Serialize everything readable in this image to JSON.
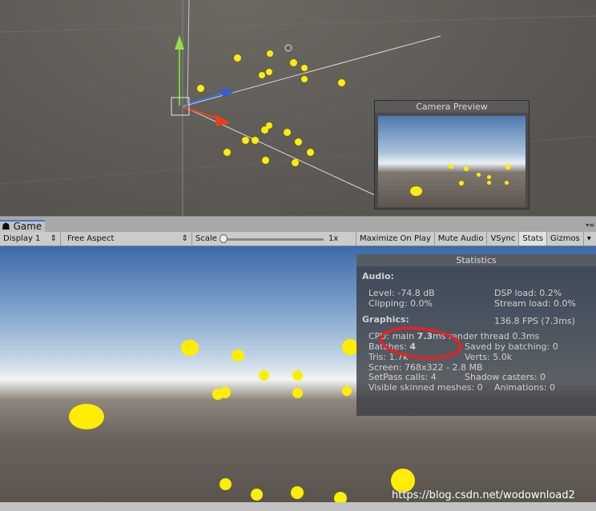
{
  "preview": {
    "title": "Camera Preview"
  },
  "tab": {
    "label": "Game"
  },
  "toolbar": {
    "display": "Display 1",
    "aspect": "Free Aspect",
    "scale_label": "Scale",
    "scale_value": "1x",
    "maximize": "Maximize On Play",
    "mute": "Mute Audio",
    "vsync": "VSync",
    "stats": "Stats",
    "gizmos": "Gizmos"
  },
  "stats": {
    "title": "Statistics",
    "audio": "Audio:",
    "level": "Level: -74.8 dB",
    "clipping": "Clipping: 0.0%",
    "dsp": "DSP load: 0.2%",
    "stream": "Stream load: 0.0%",
    "graphics": "Graphics:",
    "fps": "136.8 FPS (7.3ms)",
    "cpu_pre": "CPU: main ",
    "cpu_main": "7.3",
    "cpu_post": "ms  render thread 0.3ms",
    "batches_pre": "Batches: ",
    "batches": "4",
    "saved": "Saved by batching: 0",
    "tris": "Tris: 1.7k",
    "verts": "Verts: 5.0k",
    "screen": "Screen: 768x322 - 2.8 MB",
    "setpass": "SetPass calls: 4",
    "shadow": "Shadow casters: 0",
    "skinned": "Visible skinned meshes: 0",
    "animations": "Animations: 0"
  },
  "colors": {
    "highlight_circle": "#ff1a1a",
    "sphere": "#ffee00"
  },
  "watermark": "https://blog.csdn.net/wodownload2"
}
